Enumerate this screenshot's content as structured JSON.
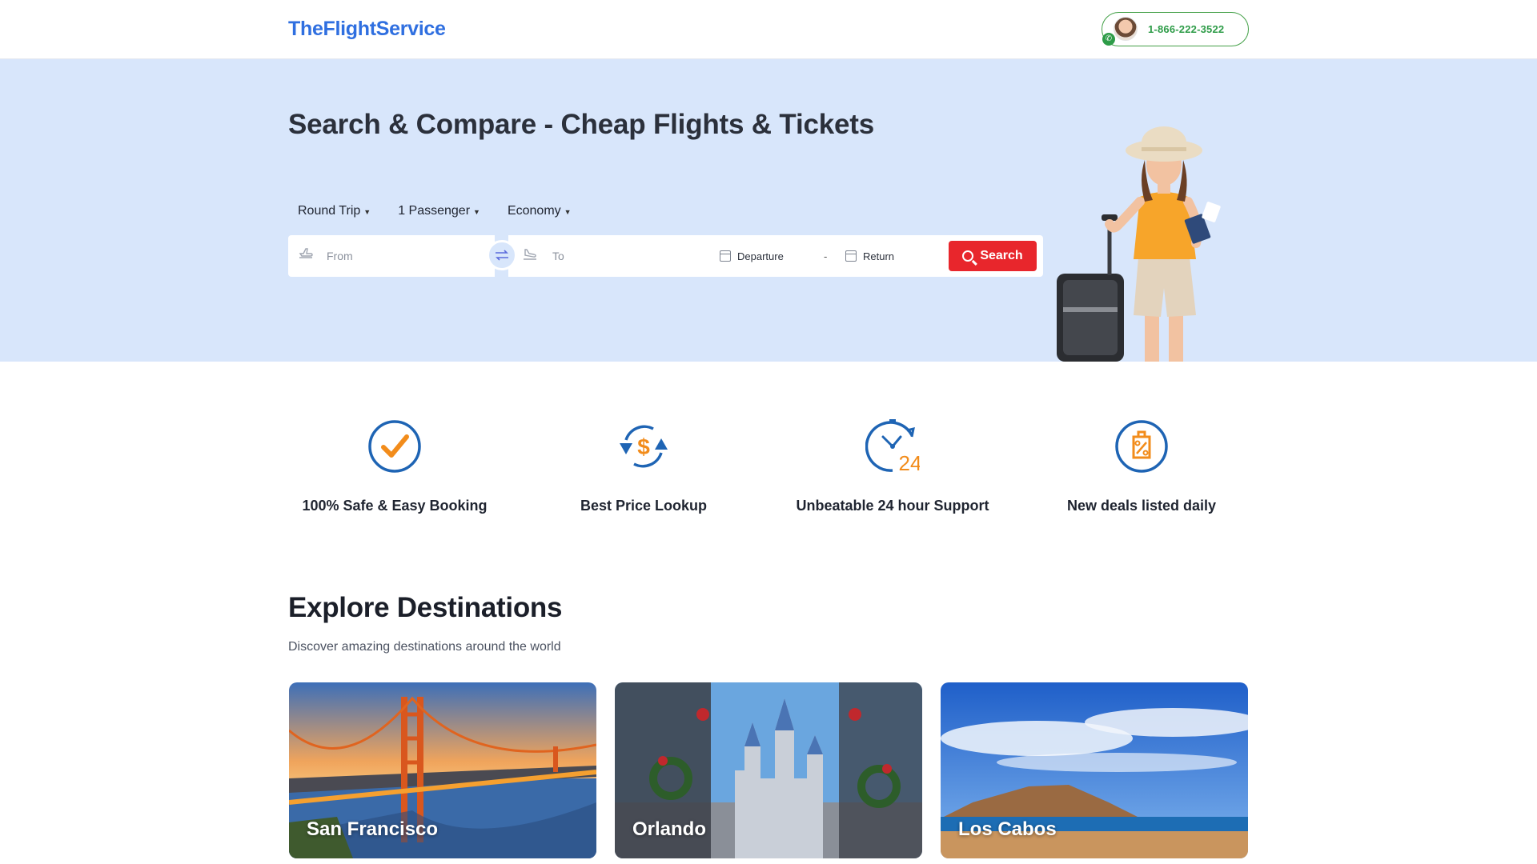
{
  "header": {
    "logo": "TheFlightService",
    "phone": "1-866-222-3522"
  },
  "hero": {
    "title": "Search & Compare - Cheap Flights & Tickets",
    "options": [
      {
        "label": "Round Trip"
      },
      {
        "label": "1 Passenger"
      },
      {
        "label": "Economy"
      }
    ],
    "from_placeholder": "From",
    "to_placeholder": "To",
    "departure_label": "Departure",
    "dash": "-",
    "return_label": "Return",
    "search_label": "Search"
  },
  "features": [
    {
      "label": "100% Safe & Easy Booking",
      "icon": "check-circle-icon"
    },
    {
      "label": "Best Price Lookup",
      "icon": "price-refresh-icon"
    },
    {
      "label": "Unbeatable 24 hour Support",
      "icon": "24-hour-clock-icon"
    },
    {
      "label": "New deals listed daily",
      "icon": "deal-tag-icon"
    }
  ],
  "destinations": {
    "title": "Explore Destinations",
    "subtitle": "Discover amazing destinations around the world",
    "cards": [
      {
        "name": "San Francisco"
      },
      {
        "name": "Orlando"
      },
      {
        "name": "Los Cabos"
      }
    ]
  },
  "colors": {
    "brand": "#2f6fe0",
    "hero_bg": "#d8e6fb",
    "search_button": "#e8262c",
    "phone_green": "#2e9c48",
    "feature_orange": "#f28c1b",
    "feature_blue": "#1e64b4"
  }
}
